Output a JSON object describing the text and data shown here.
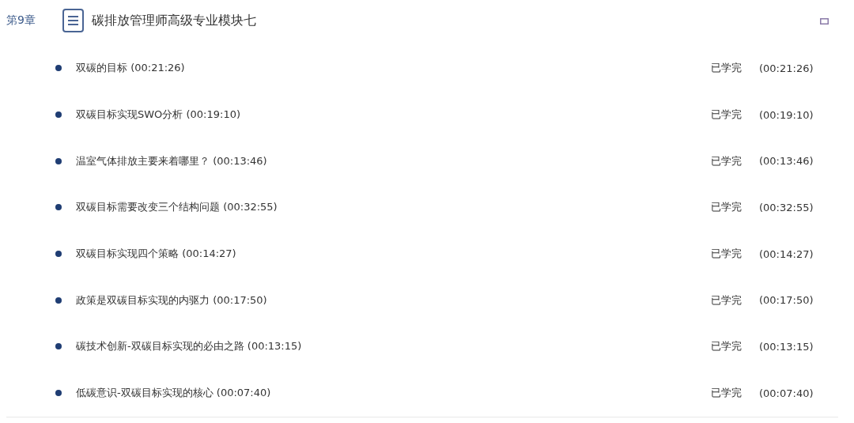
{
  "chapter": {
    "number": "第9章",
    "title": "碳排放管理师高级专业模块七"
  },
  "lessons": [
    {
      "title": "双碳的目标 (00:21:26)",
      "status": "已学完",
      "duration": "(00:21:26)"
    },
    {
      "title": "双碳目标实现SWO分析 (00:19:10)",
      "status": "已学完",
      "duration": "(00:19:10)"
    },
    {
      "title": "温室气体排放主要来着哪里？ (00:13:46)",
      "status": "已学完",
      "duration": "(00:13:46)"
    },
    {
      "title": "双碳目标需要改变三个结构问题 (00:32:55)",
      "status": "已学完",
      "duration": "(00:32:55)"
    },
    {
      "title": "双碳目标实现四个策略 (00:14:27)",
      "status": "已学完",
      "duration": "(00:14:27)"
    },
    {
      "title": "政策是双碳目标实现的内驱力 (00:17:50)",
      "status": "已学完",
      "duration": "(00:17:50)"
    },
    {
      "title": "碳技术创新-双碳目标实现的必由之路 (00:13:15)",
      "status": "已学完",
      "duration": "(00:13:15)"
    },
    {
      "title": "低碳意识-双碳目标实现的核心 (00:07:40)",
      "status": "已学完",
      "duration": "(00:07:40)"
    }
  ]
}
